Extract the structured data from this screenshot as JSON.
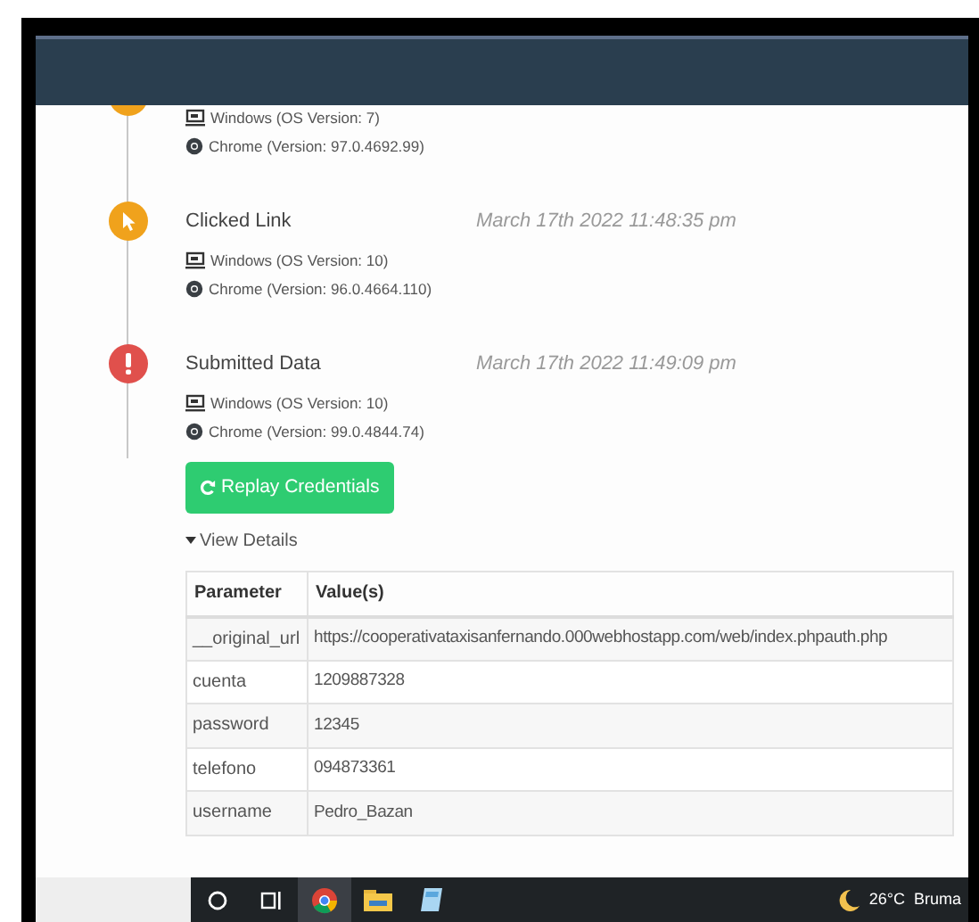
{
  "timeline": [
    {
      "kind": "cut",
      "color": "#f0a21c",
      "os": "Windows (OS Version: 7)",
      "browser": "Chrome (Version: 97.0.4692.99)"
    },
    {
      "kind": "click",
      "color": "#f0a21c",
      "title": "Clicked Link",
      "time": "March 17th 2022 11:48:35 pm",
      "os": "Windows (OS Version: 10)",
      "browser": "Chrome (Version: 96.0.4664.110)"
    },
    {
      "kind": "submit",
      "color": "#e0504c",
      "title": "Submitted Data",
      "time": "March 17th 2022 11:49:09 pm",
      "os": "Windows (OS Version: 10)",
      "browser": "Chrome (Version: 99.0.4844.74)"
    }
  ],
  "replay_button": "Replay Credentials",
  "details": {
    "label": "View Details",
    "expanded": true
  },
  "table": {
    "columns": [
      "Parameter",
      "Value(s)"
    ],
    "rows": [
      [
        "__original_url",
        "https://cooperativataxisanfernando.000webhostapp.com/web/index.phpauth.php"
      ],
      [
        "cuenta",
        "1209887328"
      ],
      [
        "password",
        "12345"
      ],
      [
        "telefono",
        "094873361"
      ],
      [
        "username",
        "Pedro_Bazan"
      ]
    ]
  },
  "taskbar": {
    "apps": [
      {
        "kind": "search",
        "selected": false
      },
      {
        "kind": "taskview",
        "selected": false
      },
      {
        "kind": "chrome",
        "selected": true
      },
      {
        "kind": "folder",
        "selected": false
      },
      {
        "kind": "notes",
        "selected": false
      }
    ],
    "temperature": "26°C",
    "weather": "Bruma"
  }
}
